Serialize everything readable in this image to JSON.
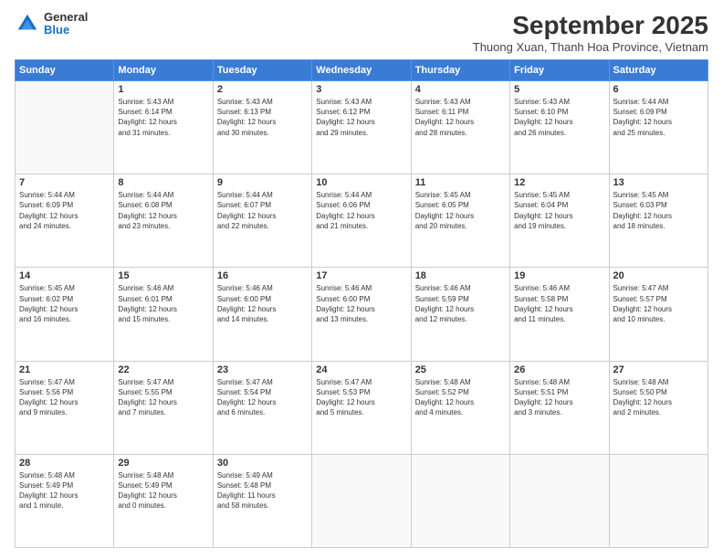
{
  "logo": {
    "general": "General",
    "blue": "Blue"
  },
  "title": "September 2025",
  "subtitle": "Thuong Xuan, Thanh Hoa Province, Vietnam",
  "header_days": [
    "Sunday",
    "Monday",
    "Tuesday",
    "Wednesday",
    "Thursday",
    "Friday",
    "Saturday"
  ],
  "weeks": [
    [
      {
        "day": "",
        "info": ""
      },
      {
        "day": "1",
        "info": "Sunrise: 5:43 AM\nSunset: 6:14 PM\nDaylight: 12 hours\nand 31 minutes."
      },
      {
        "day": "2",
        "info": "Sunrise: 5:43 AM\nSunset: 6:13 PM\nDaylight: 12 hours\nand 30 minutes."
      },
      {
        "day": "3",
        "info": "Sunrise: 5:43 AM\nSunset: 6:12 PM\nDaylight: 12 hours\nand 29 minutes."
      },
      {
        "day": "4",
        "info": "Sunrise: 5:43 AM\nSunset: 6:11 PM\nDaylight: 12 hours\nand 28 minutes."
      },
      {
        "day": "5",
        "info": "Sunrise: 5:43 AM\nSunset: 6:10 PM\nDaylight: 12 hours\nand 26 minutes."
      },
      {
        "day": "6",
        "info": "Sunrise: 5:44 AM\nSunset: 6:09 PM\nDaylight: 12 hours\nand 25 minutes."
      }
    ],
    [
      {
        "day": "7",
        "info": "Sunrise: 5:44 AM\nSunset: 6:09 PM\nDaylight: 12 hours\nand 24 minutes."
      },
      {
        "day": "8",
        "info": "Sunrise: 5:44 AM\nSunset: 6:08 PM\nDaylight: 12 hours\nand 23 minutes."
      },
      {
        "day": "9",
        "info": "Sunrise: 5:44 AM\nSunset: 6:07 PM\nDaylight: 12 hours\nand 22 minutes."
      },
      {
        "day": "10",
        "info": "Sunrise: 5:44 AM\nSunset: 6:06 PM\nDaylight: 12 hours\nand 21 minutes."
      },
      {
        "day": "11",
        "info": "Sunrise: 5:45 AM\nSunset: 6:05 PM\nDaylight: 12 hours\nand 20 minutes."
      },
      {
        "day": "12",
        "info": "Sunrise: 5:45 AM\nSunset: 6:04 PM\nDaylight: 12 hours\nand 19 minutes."
      },
      {
        "day": "13",
        "info": "Sunrise: 5:45 AM\nSunset: 6:03 PM\nDaylight: 12 hours\nand 18 minutes."
      }
    ],
    [
      {
        "day": "14",
        "info": "Sunrise: 5:45 AM\nSunset: 6:02 PM\nDaylight: 12 hours\nand 16 minutes."
      },
      {
        "day": "15",
        "info": "Sunrise: 5:46 AM\nSunset: 6:01 PM\nDaylight: 12 hours\nand 15 minutes."
      },
      {
        "day": "16",
        "info": "Sunrise: 5:46 AM\nSunset: 6:00 PM\nDaylight: 12 hours\nand 14 minutes."
      },
      {
        "day": "17",
        "info": "Sunrise: 5:46 AM\nSunset: 6:00 PM\nDaylight: 12 hours\nand 13 minutes."
      },
      {
        "day": "18",
        "info": "Sunrise: 5:46 AM\nSunset: 5:59 PM\nDaylight: 12 hours\nand 12 minutes."
      },
      {
        "day": "19",
        "info": "Sunrise: 5:46 AM\nSunset: 5:58 PM\nDaylight: 12 hours\nand 11 minutes."
      },
      {
        "day": "20",
        "info": "Sunrise: 5:47 AM\nSunset: 5:57 PM\nDaylight: 12 hours\nand 10 minutes."
      }
    ],
    [
      {
        "day": "21",
        "info": "Sunrise: 5:47 AM\nSunset: 5:56 PM\nDaylight: 12 hours\nand 9 minutes."
      },
      {
        "day": "22",
        "info": "Sunrise: 5:47 AM\nSunset: 5:55 PM\nDaylight: 12 hours\nand 7 minutes."
      },
      {
        "day": "23",
        "info": "Sunrise: 5:47 AM\nSunset: 5:54 PM\nDaylight: 12 hours\nand 6 minutes."
      },
      {
        "day": "24",
        "info": "Sunrise: 5:47 AM\nSunset: 5:53 PM\nDaylight: 12 hours\nand 5 minutes."
      },
      {
        "day": "25",
        "info": "Sunrise: 5:48 AM\nSunset: 5:52 PM\nDaylight: 12 hours\nand 4 minutes."
      },
      {
        "day": "26",
        "info": "Sunrise: 5:48 AM\nSunset: 5:51 PM\nDaylight: 12 hours\nand 3 minutes."
      },
      {
        "day": "27",
        "info": "Sunrise: 5:48 AM\nSunset: 5:50 PM\nDaylight: 12 hours\nand 2 minutes."
      }
    ],
    [
      {
        "day": "28",
        "info": "Sunrise: 5:48 AM\nSunset: 5:49 PM\nDaylight: 12 hours\nand 1 minute."
      },
      {
        "day": "29",
        "info": "Sunrise: 5:48 AM\nSunset: 5:49 PM\nDaylight: 12 hours\nand 0 minutes."
      },
      {
        "day": "30",
        "info": "Sunrise: 5:49 AM\nSunset: 5:48 PM\nDaylight: 11 hours\nand 58 minutes."
      },
      {
        "day": "",
        "info": ""
      },
      {
        "day": "",
        "info": ""
      },
      {
        "day": "",
        "info": ""
      },
      {
        "day": "",
        "info": ""
      }
    ]
  ]
}
